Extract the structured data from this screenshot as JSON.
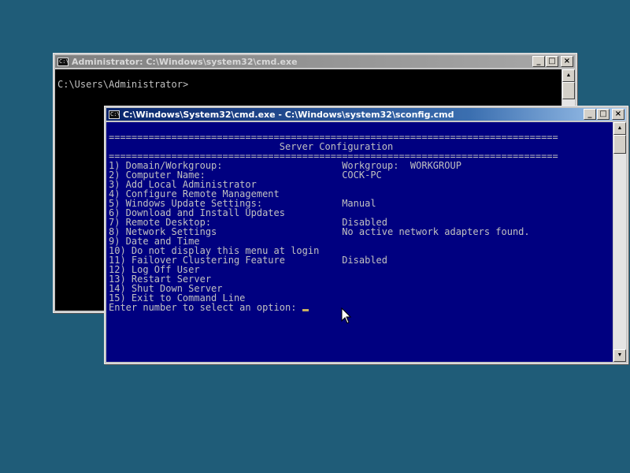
{
  "desktop": {
    "background": "#1f5c78"
  },
  "window_back": {
    "title": "Administrator: C:\\Windows\\system32\\cmd.exe",
    "icon_label": "C:\\",
    "prompt": "C:\\Users\\Administrator>"
  },
  "window_front": {
    "title": "C:\\Windows\\System32\\cmd.exe - C:\\Windows\\system32\\sconfig.cmd",
    "icon_label": "C:\\",
    "console_lines": [
      "===============================================================================",
      "                              Server Configuration",
      "===============================================================================",
      "",
      "1) Domain/Workgroup:                     Workgroup:  WORKGROUP",
      "2) Computer Name:                        COCK-PC",
      "3) Add Local Administrator",
      "4) Configure Remote Management",
      "",
      "5) Windows Update Settings:              Manual",
      "6) Download and Install Updates",
      "7) Remote Desktop:                       Disabled",
      "",
      "8) Network Settings                      No active network adapters found.",
      "9) Date and Time",
      "10) Do not display this menu at login",
      "11) Failover Clustering Feature          Disabled",
      "",
      "12) Log Off User",
      "13) Restart Server",
      "14) Shut Down Server",
      "15) Exit to Command Line",
      "",
      "Enter number to select an option: "
    ]
  },
  "window_controls": {
    "minimize": "_",
    "maximize": "□",
    "close": "×"
  },
  "scroll_glyphs": {
    "up": "▲",
    "down": "▼"
  }
}
